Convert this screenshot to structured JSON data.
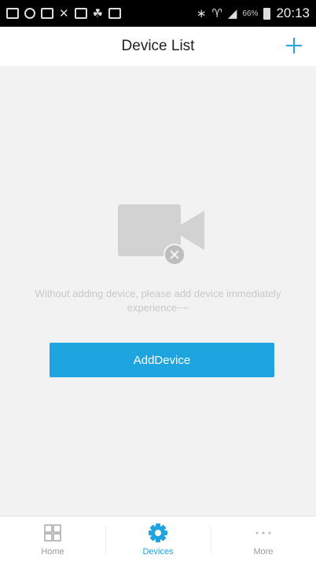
{
  "status_bar": {
    "icons": [
      "message-icon",
      "notification-icon",
      "gallery-icon",
      "missed-call-icon",
      "app-icon",
      "cat-icon",
      "app-icon-2",
      "bluetooth-icon",
      "wifi-icon",
      "signal-icon"
    ],
    "battery": "66%",
    "time": "20:13"
  },
  "nav": {
    "title": "Device List",
    "add_icon": "plus-icon"
  },
  "empty_state": {
    "icon": "camera-offline-icon",
    "message_line1": "Without adding device, please add device immediately",
    "message_line2": "experience~~",
    "button_label": "AddDevice"
  },
  "tabs": [
    {
      "label": "Home",
      "icon": "grid-icon",
      "active": false
    },
    {
      "label": "Devices",
      "icon": "gear-icon",
      "active": true
    },
    {
      "label": "More",
      "icon": "more-icon",
      "active": false
    }
  ],
  "colors": {
    "accent": "#1ea5e0",
    "background": "#f2f2f2",
    "icon_gray": "#d2d2d2"
  }
}
